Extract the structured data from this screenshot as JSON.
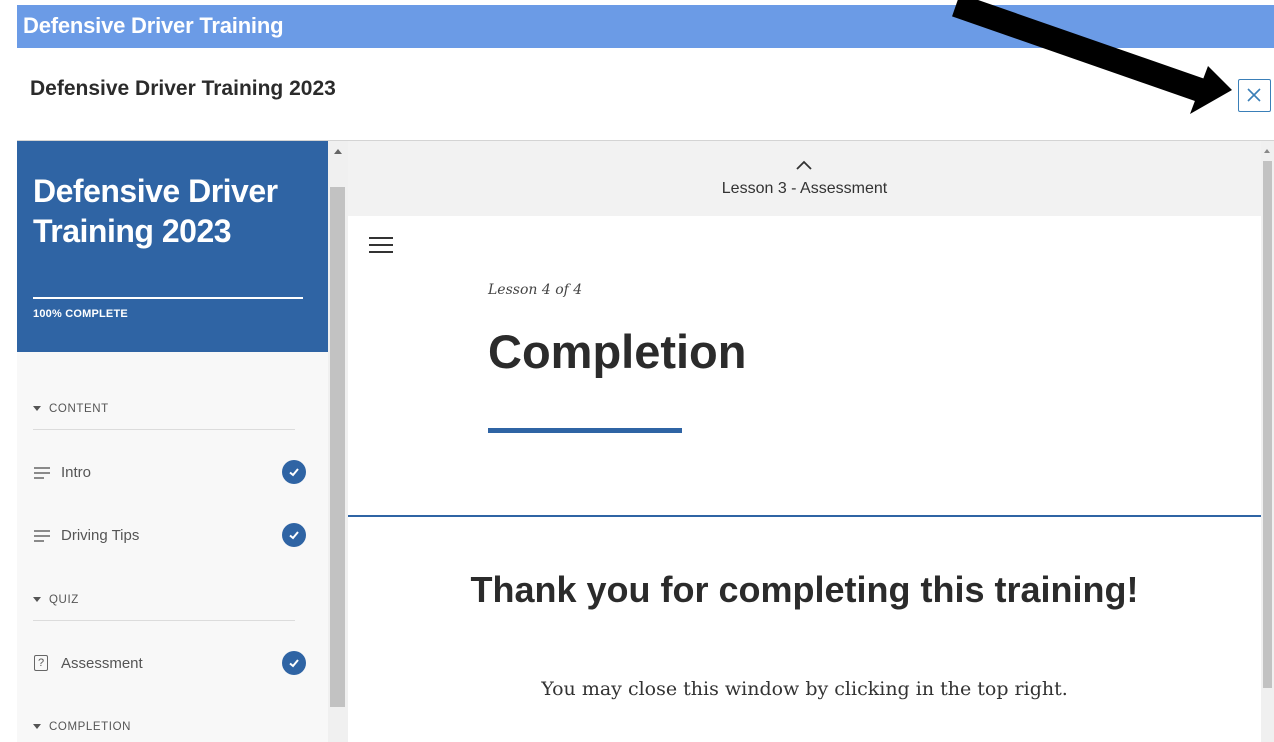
{
  "app": {
    "title": "Defensive Driver Training"
  },
  "modal": {
    "title": "Defensive Driver Training 2023",
    "close_label": "×"
  },
  "sidebar": {
    "course_title": "Defensive Driver Training 2023",
    "progress_label": "100% COMPLETE",
    "progress_value": 1.0,
    "sections": [
      {
        "label": "CONTENT"
      },
      {
        "label": "QUIZ"
      },
      {
        "label": "COMPLETION"
      }
    ],
    "items": [
      {
        "label": "Intro",
        "icon": "lines-icon",
        "completed": true
      },
      {
        "label": "Driving Tips",
        "icon": "lines-icon",
        "completed": true
      },
      {
        "label": "Assessment",
        "icon": "question-box-icon",
        "completed": true
      }
    ],
    "question_glyph": "?"
  },
  "main": {
    "previous_lesson": "Lesson 3 - Assessment",
    "lesson_count": "Lesson 4 of 4",
    "lesson_title": "Completion",
    "thanks_heading": "Thank you for completing this training!",
    "thanks_text": "You may close this window by clicking in the top right."
  },
  "colors": {
    "accent": "#2f64a4",
    "topbar": "#6b9be6",
    "arrow": "#000000"
  }
}
